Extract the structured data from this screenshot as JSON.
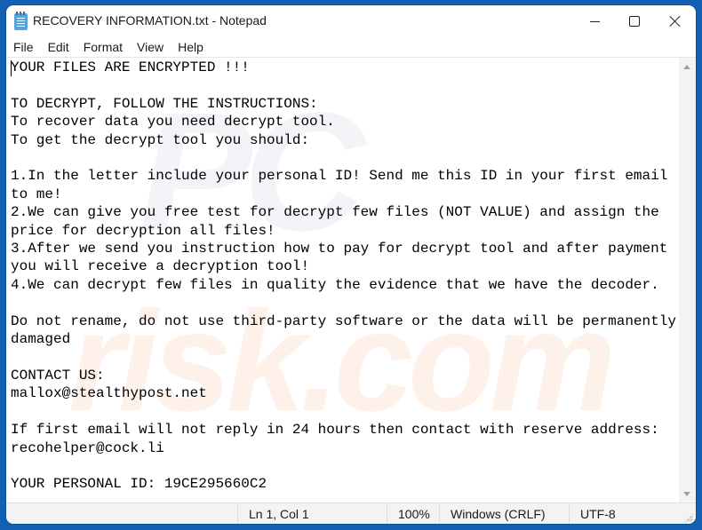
{
  "window": {
    "title": "RECOVERY INFORMATION.txt - Notepad",
    "app_icon": "notepad-icon",
    "controls": {
      "minimize": "minimize-icon",
      "maximize": "maximize-icon",
      "close": "close-icon"
    }
  },
  "menu": {
    "items": [
      {
        "label": "File"
      },
      {
        "label": "Edit"
      },
      {
        "label": "Format"
      },
      {
        "label": "View"
      },
      {
        "label": "Help"
      }
    ]
  },
  "editor": {
    "watermark_top": "PC",
    "watermark_bottom": "risk.com",
    "lines": [
      "YOUR FILES ARE ENCRYPTED !!!",
      "",
      "TO DECRYPT, FOLLOW THE INSTRUCTIONS:",
      "To recover data you need decrypt tool.",
      "To get the decrypt tool you should:",
      "",
      "1.In the letter include your personal ID! Send me this ID in your first email to me!",
      "2.We can give you free test for decrypt few files (NOT VALUE) and assign the price for decryption all files!",
      "3.After we send you instruction how to pay for decrypt tool and after payment you will receive a decryption tool!",
      "4.We can decrypt few files in quality the evidence that we have the decoder.",
      "",
      "Do not rename, do not use third-party software or the data will be permanently damaged",
      "",
      "CONTACT US:",
      "mallox@stealthypost.net",
      "",
      "If first email will not reply in 24 hours then contact with reserve address:",
      "recohelper@cock.li",
      "",
      "YOUR PERSONAL ID: 19CE295660C2"
    ]
  },
  "statusbar": {
    "position": "Ln 1, Col 1",
    "zoom": "100%",
    "line_endings": "Windows (CRLF)",
    "encoding": "UTF-8"
  }
}
